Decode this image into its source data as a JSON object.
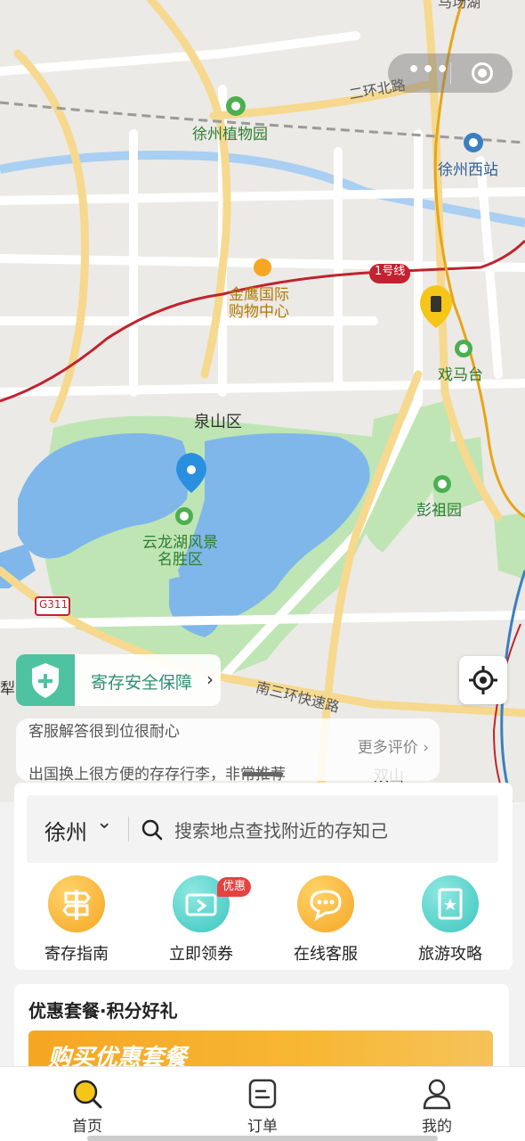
{
  "map": {
    "labels": {
      "ring_road_north": "二环北路",
      "xuzhou_botanical_garden": "徐州植物园",
      "xuzhou_west_station": "徐州西站",
      "metro_line1": "1号线",
      "jinying_mall": "金鹰国际\n购物中心",
      "ximatai": "戏马台",
      "quanshan_district": "泉山区",
      "pengzu_garden": "彭祖园",
      "yunlong_lake": "云龙湖风景\n名胜区",
      "g311": "G311",
      "south_third_ring": "南三环快速路",
      "li": "犁山",
      "shuangshan": "双山",
      "top_label": "马场湖"
    },
    "controls": {
      "more_icon": "more-dots-icon",
      "close_icon": "target-circle-icon",
      "locate_icon": "crosshair-icon"
    }
  },
  "safety_bar": {
    "label": "寄存安全保障",
    "icon": "shield-plus-icon"
  },
  "review_card": {
    "line1": "客服解答很到位很耐心",
    "more_label": "更多评价",
    "line2": "出国换上很方便的存存行李，非常推荐"
  },
  "search": {
    "city": "徐州",
    "placeholder": "搜索地点查找附近的存知己"
  },
  "services": [
    {
      "label": "寄存指南",
      "icon": "signpost-icon",
      "color": "#f5a623"
    },
    {
      "label": "立即领券",
      "icon": "ticket-icon",
      "color": "#3cc6c0",
      "badge": "优惠"
    },
    {
      "label": "在线客服",
      "icon": "chat-bubble-icon",
      "color": "#f5a623"
    },
    {
      "label": "旅游攻略",
      "icon": "guidebook-icon",
      "color": "#3cc6c0"
    }
  ],
  "promo": {
    "title": "优惠套餐·积分好礼",
    "banner_text": "购买优惠套餐"
  },
  "tabs": [
    {
      "label": "首页",
      "icon": "home-search-icon",
      "active": true
    },
    {
      "label": "订单",
      "icon": "order-list-icon",
      "active": false
    },
    {
      "label": "我的",
      "icon": "user-icon",
      "active": false
    }
  ],
  "colors": {
    "accent": "#f5a623",
    "teal": "#3cc6c0",
    "metro_red": "#c0232f",
    "lake_blue": "#7ab4e8",
    "park_green": "#b9e3b0"
  }
}
